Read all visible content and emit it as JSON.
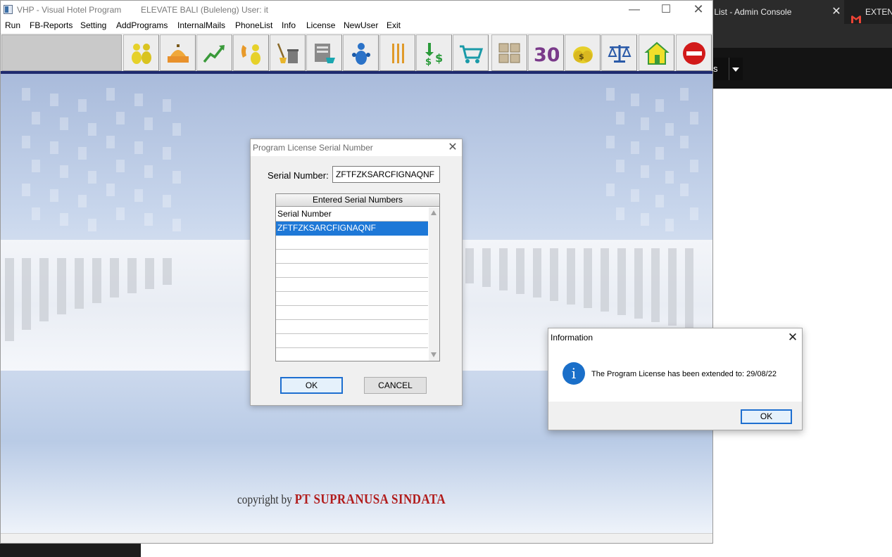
{
  "window": {
    "title": "VHP - Visual Hotel Program",
    "subtitle": "ELEVATE BALI (Buleleng) User: it"
  },
  "menu": [
    "Run",
    "FB-Reports",
    "Setting",
    "AddPrograms",
    "InternalMails",
    "PhoneList",
    "Info",
    "License",
    "NewUser",
    "Exit"
  ],
  "toolbar": {
    "buttons": [
      {
        "icon": "guests-icon"
      },
      {
        "icon": "front-desk-bell-icon"
      },
      {
        "icon": "trend-chart-icon"
      },
      {
        "icon": "telephone-operator-icon"
      },
      {
        "icon": "housekeeping-icon"
      },
      {
        "icon": "cashier-register-icon"
      },
      {
        "icon": "sales-people-icon"
      },
      {
        "icon": "restaurant-cutlery-icon"
      },
      {
        "icon": "money-transfer-icon"
      },
      {
        "icon": "shopping-cart-icon"
      },
      {
        "icon": "inventory-boxes-icon"
      },
      {
        "icon": "day-30-icon",
        "text": "30"
      },
      {
        "icon": "money-bags-icon"
      },
      {
        "icon": "balance-scale-icon"
      },
      {
        "icon": "property-house-icon"
      },
      {
        "icon": "stop-exit-icon"
      }
    ]
  },
  "copyright": {
    "prefix": "copyright by",
    "company": "PT SUPRANUSA SINDATA"
  },
  "license_dialog": {
    "title": "Program License Serial Number",
    "serial_label": "Serial Number:",
    "serial_value": "ZFTFZKSARCFIGNAQNF",
    "list_header": "Entered Serial Numbers",
    "rows": [
      "Serial Number",
      "ZFTFZKSARCFIGNAQNF",
      "",
      "",
      "",
      "",
      "",
      "",
      "",
      ""
    ],
    "ok_label": "OK",
    "cancel_label": "CANCEL"
  },
  "info_dialog": {
    "title": "Information",
    "message": "The Program License has been extended to: 29/08/22",
    "ok_label": "OK"
  },
  "background_browser": {
    "tab1": "r List - Admin Console",
    "tab2": "EXTEN",
    "dropdown_text": "s"
  },
  "colors": {
    "accent_blue": "#1e78d7",
    "brand_red": "#b11c1c",
    "toolbar_separator": "#1e2a6e"
  }
}
